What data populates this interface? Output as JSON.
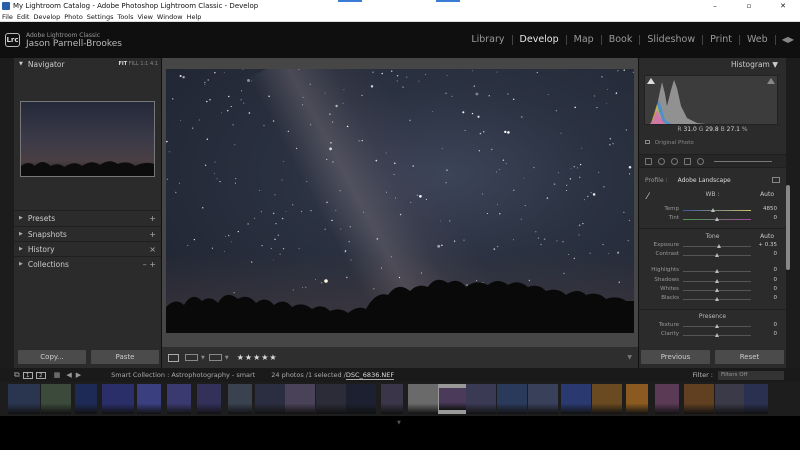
{
  "window": {
    "title": "My Lightroom Catalog - Adobe Photoshop Lightroom Classic - Develop",
    "minimize": "–",
    "maximize": "▫",
    "close": "✕"
  },
  "menu": [
    "File",
    "Edit",
    "Develop",
    "Photo",
    "Settings",
    "Tools",
    "View",
    "Window",
    "Help"
  ],
  "identity": {
    "logo": "Lrc",
    "app_name": "Adobe Lightroom Classic",
    "user_name": "Jason Parnell-Brookes"
  },
  "modules": [
    {
      "label": "Library",
      "active": false
    },
    {
      "label": "Develop",
      "active": true
    },
    {
      "label": "Map",
      "active": false
    },
    {
      "label": "Book",
      "active": false
    },
    {
      "label": "Slideshow",
      "active": false
    },
    {
      "label": "Print",
      "active": false
    },
    {
      "label": "Web",
      "active": false
    }
  ],
  "left_panel": {
    "navigator": {
      "title": "Navigator",
      "zoom": [
        "FIT",
        "FILL",
        "1:1",
        "4:1"
      ]
    },
    "sections": [
      {
        "label": "Presets",
        "action": "+"
      },
      {
        "label": "Snapshots",
        "action": "+"
      },
      {
        "label": "History",
        "action": "×"
      },
      {
        "label": "Collections",
        "action": "– +"
      }
    ],
    "copy_label": "Copy...",
    "paste_label": "Paste"
  },
  "toolbar": {
    "rating": "★★★★★"
  },
  "right_panel": {
    "histogram_title": "Histogram ▼",
    "rgb": {
      "r_label": "R",
      "r": "31.0",
      "g_label": "G",
      "g": "29.8",
      "b_label": "B",
      "b": "27.1",
      "unit": "%"
    },
    "original_photo": "Original Photo",
    "profile_label": "Profile :",
    "profile_value": "Adobe Landscape",
    "wb_label": "WB :",
    "wb_value": "Auto",
    "tone_label": "Tone",
    "tone_auto": "Auto",
    "presence_label": "Presence",
    "sliders": {
      "temp": {
        "label": "Temp",
        "value": "4850",
        "level": 0.45
      },
      "tint": {
        "label": "Tint",
        "value": "0",
        "level": 0.5
      },
      "exposure": {
        "label": "Exposure",
        "value": "+ 0.35",
        "level": 0.53
      },
      "contrast": {
        "label": "Contrast",
        "value": "0",
        "level": 0.5
      },
      "highlights": {
        "label": "Highlights",
        "value": "0",
        "level": 0.5
      },
      "shadows": {
        "label": "Shadows",
        "value": "0",
        "level": 0.5
      },
      "whites": {
        "label": "Whites",
        "value": "0",
        "level": 0.5
      },
      "blacks": {
        "label": "Blacks",
        "value": "0",
        "level": 0.5
      },
      "texture": {
        "label": "Texture",
        "value": "0",
        "level": 0.5
      },
      "clarity": {
        "label": "Clarity",
        "value": "0",
        "level": 0.5
      }
    },
    "previous_label": "Previous",
    "reset_label": "Reset"
  },
  "filmstrip": {
    "source": "Smart Collection : Astrophotography - smart",
    "count": "24 photos /1 selected /",
    "selected_file": "DSC_6836.NEF",
    "filter_label": "Filter :",
    "filter_value": "Filters Off"
  }
}
